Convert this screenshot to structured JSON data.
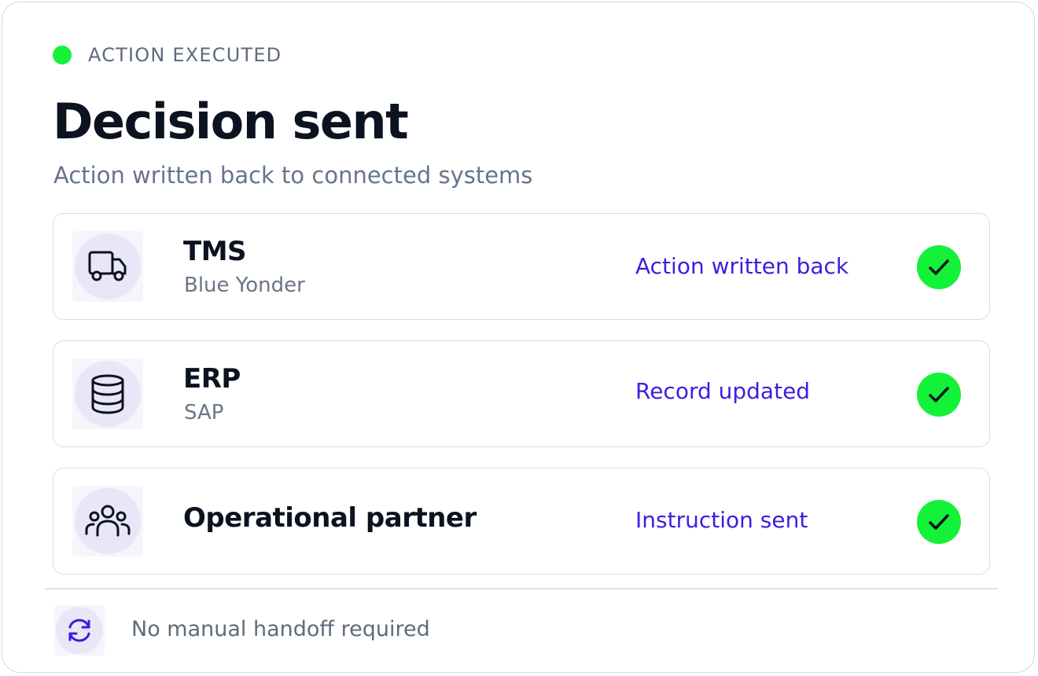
{
  "status": {
    "label": "ACTION EXECUTED",
    "dot_color": "#16f23a"
  },
  "title": "Decision sent",
  "subtitle": "Action written back to connected systems",
  "systems": [
    {
      "name": "TMS",
      "vendor": "Blue Yonder",
      "status": "Action written back",
      "icon": "truck-icon",
      "completed": true
    },
    {
      "name": "ERP",
      "vendor": "SAP",
      "status": "Record updated",
      "icon": "database-icon",
      "completed": true
    },
    {
      "name": "Operational partner",
      "vendor": "",
      "status": "Instruction sent",
      "icon": "users-icon",
      "completed": true
    }
  ],
  "footer": {
    "text": "No manual handoff required",
    "icon": "sync-icon"
  },
  "colors": {
    "accent": "#3b1fe0",
    "success": "#14f139",
    "text_primary": "#0b1220",
    "text_muted": "#66758a"
  }
}
